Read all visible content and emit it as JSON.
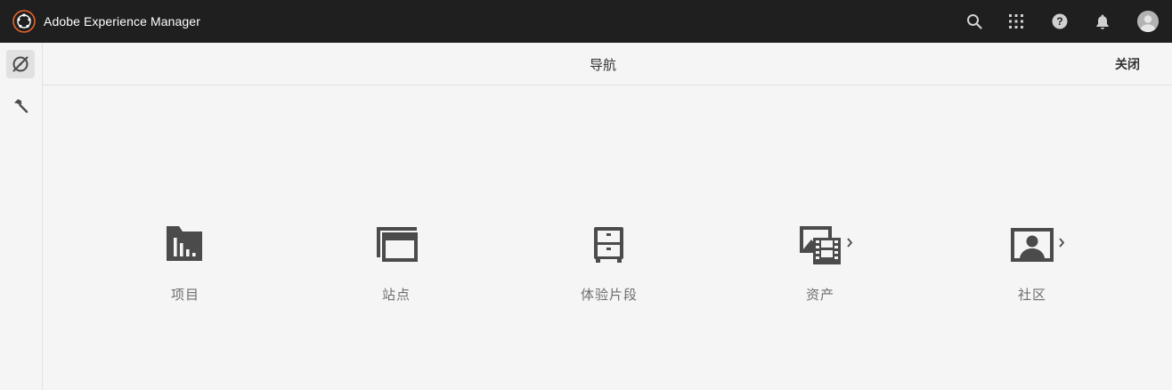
{
  "app": {
    "title": "Adobe Experience Manager",
    "logo_icon": "aem-logo-icon",
    "accent_color": "#e8632b"
  },
  "topbar": {
    "icons": [
      "search-icon",
      "apps-grid-icon",
      "help-icon",
      "bell-icon",
      "user-avatar"
    ]
  },
  "leftrail": {
    "items": [
      {
        "icon": "navigation-compass-icon",
        "active": true
      },
      {
        "icon": "tools-hammer-icon",
        "active": false
      }
    ]
  },
  "panel": {
    "title": "导航",
    "close_label": "关闭"
  },
  "nav_items": [
    {
      "label": "项目",
      "icon": "projects-folder-icon",
      "has_children": false
    },
    {
      "label": "站点",
      "icon": "sites-windows-icon",
      "has_children": false
    },
    {
      "label": "体验片段",
      "icon": "experience-fragments-cabinet-icon",
      "has_children": false
    },
    {
      "label": "资产",
      "icon": "assets-image-film-icon",
      "has_children": true
    },
    {
      "label": "社区",
      "icon": "communities-person-icon",
      "has_children": true
    }
  ]
}
